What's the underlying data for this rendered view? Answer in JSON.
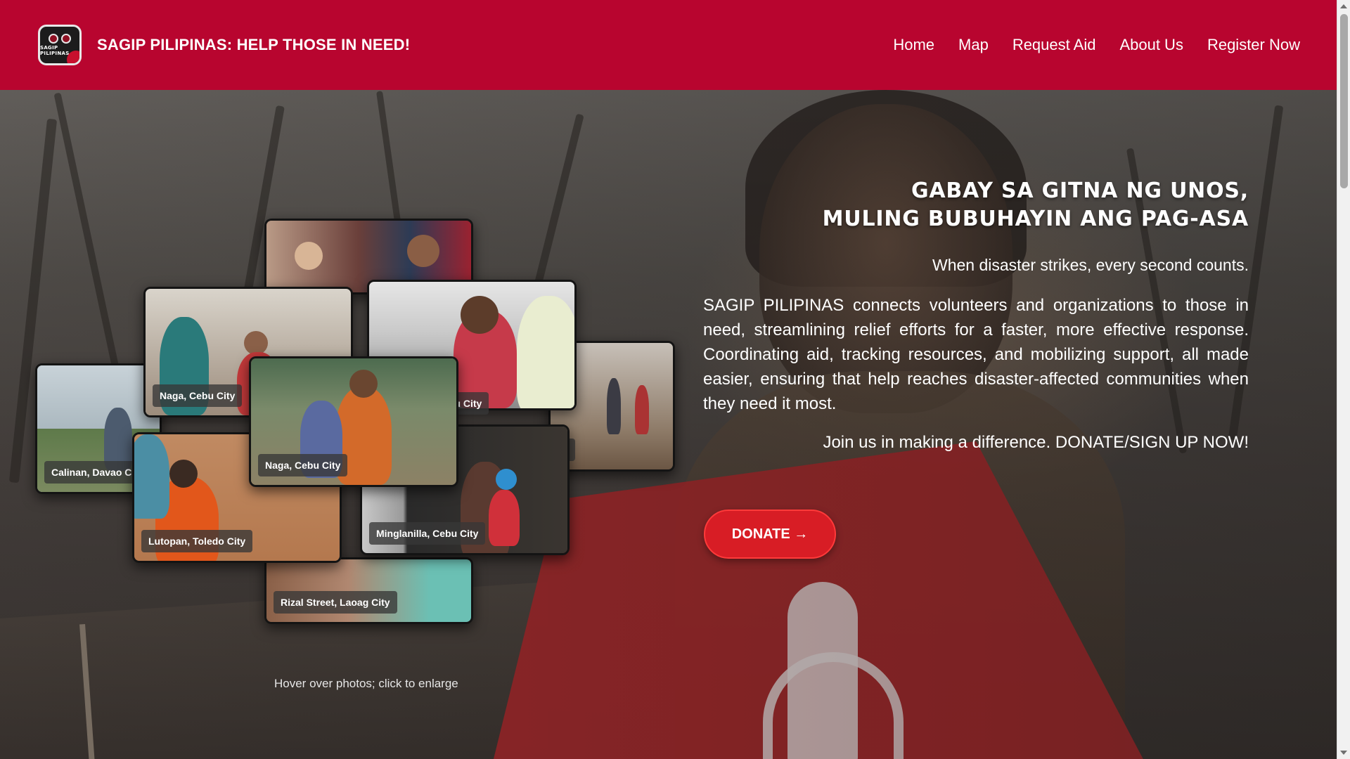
{
  "header": {
    "logo_text": "SAGIP PILIPINAS",
    "site_title": "SAGIP PILIPINAS: HELP THOSE IN NEED!",
    "nav": [
      {
        "label": "Home"
      },
      {
        "label": "Map"
      },
      {
        "label": "Request Aid"
      },
      {
        "label": "About Us"
      },
      {
        "label": "Register Now"
      }
    ]
  },
  "hero": {
    "heading_line1": "GABAY SA GITNA NG UNOS,",
    "heading_line2": "MULING BUBUHAYIN ANG PAG-ASA",
    "tagline": "When disaster strikes, every second counts.",
    "body": "SAGIP PILIPINAS connects volunteers and organizations to those in need, streamlining relief efforts for a faster, more effective response. Coordinating aid, tracking resources, and mobilizing support, all made easier, ensuring that help reaches disaster-affected communities when they need it most.",
    "join": "Join us in making a difference. DONATE/SIGN UP NOW!",
    "donate_label": "DONATE →",
    "hover_hint": "Hover over photos; click to enlarge"
  },
  "gallery": {
    "photos": [
      {
        "caption": "Calinan, Davao City"
      },
      {
        "caption": "Naga, Cebu City"
      },
      {
        "caption": "Naga, Cebu City"
      },
      {
        "caption": "Lutopan, Toledo City"
      },
      {
        "caption": "Minglanilla, Cebu City"
      },
      {
        "caption": "Rizal Street, Laoag City"
      },
      {
        "caption": "Cebu City"
      },
      {
        "caption": "Cebu City"
      }
    ]
  },
  "colors": {
    "brand_red": "#b8052f",
    "donate_red": "#d81d25",
    "text_white": "#ffffff"
  }
}
